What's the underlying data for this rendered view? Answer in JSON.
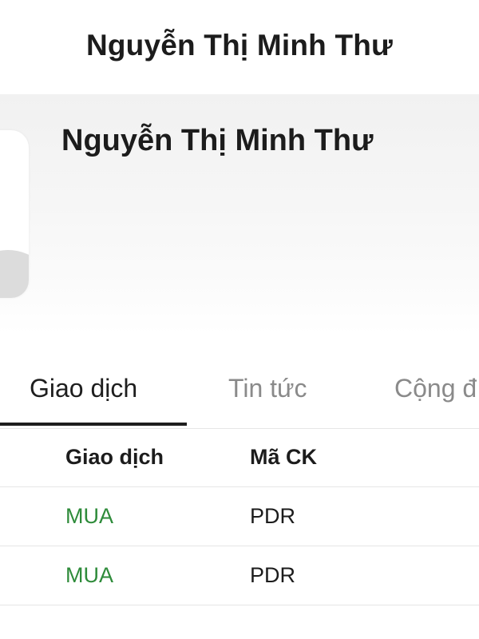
{
  "nav": {
    "title": "Nguyễn Thị Minh Thư"
  },
  "profile": {
    "name": "Nguyễn Thị Minh Thư"
  },
  "tabs": [
    {
      "label": "Giao dịch",
      "active": true
    },
    {
      "label": "Tin tức",
      "active": false
    },
    {
      "label": "Cộng đ",
      "active": false
    }
  ],
  "table": {
    "columns": [
      "Giao dịch",
      "Mã CK"
    ],
    "rows": [
      {
        "action": "MUA",
        "ticker": "PDR"
      },
      {
        "action": "MUA",
        "ticker": "PDR"
      }
    ]
  },
  "colors": {
    "buy": "#2e8b3a",
    "active_tab": "#1e1e1e",
    "inactive_tab": "#8a8a8a"
  }
}
